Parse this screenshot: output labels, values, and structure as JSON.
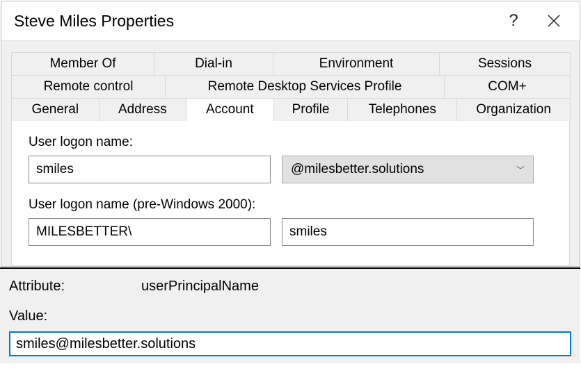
{
  "window": {
    "title": "Steve Miles Properties"
  },
  "tabs": {
    "row1": [
      {
        "label": "Member Of"
      },
      {
        "label": "Dial-in"
      },
      {
        "label": "Environment"
      },
      {
        "label": "Sessions"
      }
    ],
    "row2": [
      {
        "label": "Remote control"
      },
      {
        "label": "Remote Desktop Services Profile"
      },
      {
        "label": "COM+"
      }
    ],
    "row3": [
      {
        "label": "General"
      },
      {
        "label": "Address"
      },
      {
        "label": "Account",
        "active": true
      },
      {
        "label": "Profile"
      },
      {
        "label": "Telephones"
      },
      {
        "label": "Organization"
      }
    ]
  },
  "account": {
    "logonNameLabel": "User logon name:",
    "logonName": "smiles",
    "domainSuffix": "@milesbetter.solutions",
    "preWin2000Label": "User logon name (pre-Windows 2000):",
    "preWin2000Domain": "MILESBETTER\\",
    "preWin2000User": "smiles"
  },
  "attribute": {
    "attrLabel": "Attribute:",
    "attrName": "userPrincipalName",
    "valueLabel": "Value:",
    "value": "smiles@milesbetter.solutions"
  }
}
